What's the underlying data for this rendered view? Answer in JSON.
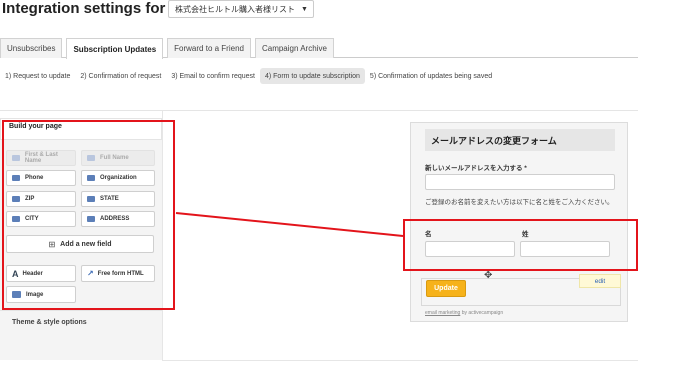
{
  "header": {
    "title": "Integration settings for list",
    "list_select": "株式会社ヒルトル購入者様リスト"
  },
  "tabs": [
    "Unsubscribes",
    "Subscription Updates",
    "Forward to a Friend",
    "Campaign Archive"
  ],
  "active_tab": "Subscription Updates",
  "steps": [
    "1) Request to update",
    "2) Confirmation of request",
    "3) Email to confirm request",
    "4) Form to update subscription",
    "5) Confirmation of updates being saved"
  ],
  "active_step": "4) Form to update subscription",
  "builder": {
    "heading": "Build your page",
    "fields": {
      "first_last": "First & Last Name",
      "full_name": "Full Name",
      "phone": "Phone",
      "organization": "Organization",
      "zip": "ZIP",
      "state": "STATE",
      "city": "CITY",
      "address": "ADDRESS"
    },
    "add_field": "Add a new field",
    "header_btn": "Header",
    "free_html": "Free form HTML",
    "image": "Image",
    "theme": "Theme & style options"
  },
  "form": {
    "title": "メールアドレスの変更フォーム",
    "email_label": "新しいメールアドレスを入力する *",
    "name_note": "ご登録のお名前を変えたい方は以下に名と姓をご入力ください。",
    "first_name_label": "名",
    "last_name_label": "姓",
    "edit_label": "edit",
    "update_button": "Update",
    "powered_link": "email marketing",
    "powered_suffix": "by activecampaign"
  },
  "colors": {
    "highlight_border": "#e3141b",
    "update_button": "#f6b21a",
    "link": "#2d63b4"
  }
}
